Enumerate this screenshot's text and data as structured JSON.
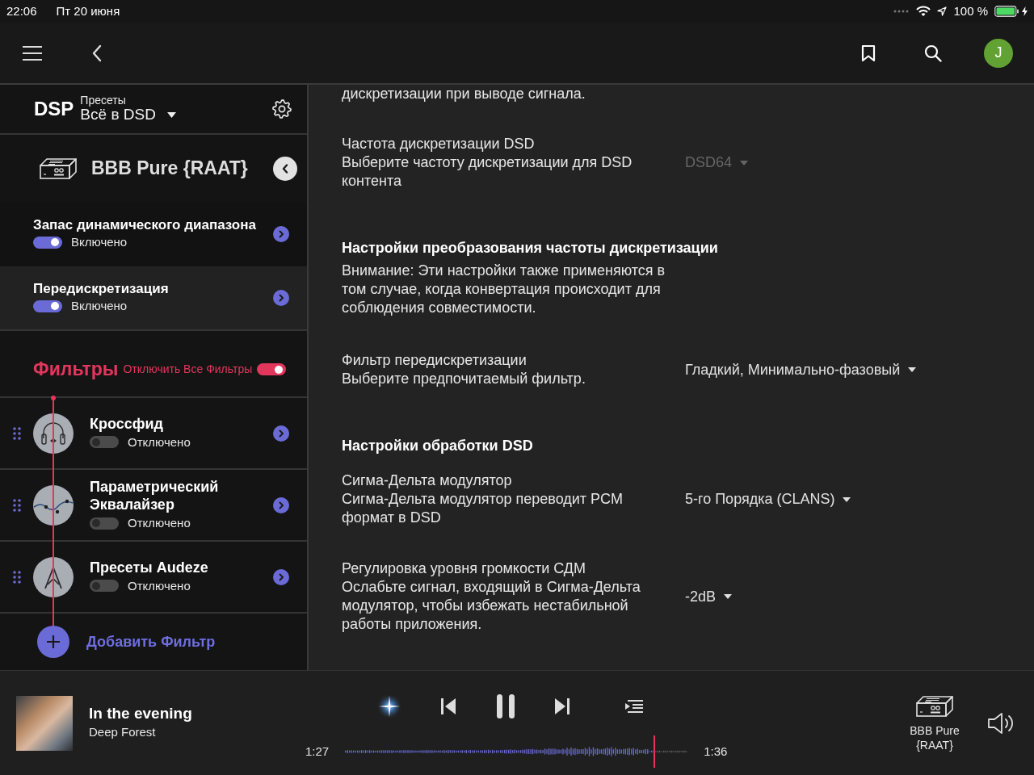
{
  "status_bar": {
    "time": "22:06",
    "date": "Пт 20 июня",
    "battery": "100 %"
  },
  "top_bar": {
    "avatar": "J"
  },
  "dsp_panel": {
    "title": "DSP",
    "presets_label": "Пресеты",
    "preset": "Всё в DSD",
    "device": "BBB Pure {RAAT}",
    "items": [
      {
        "title": "Запас динамического диапазона",
        "status": "Включено",
        "on": true,
        "selected": false
      },
      {
        "title": "Передискретизация",
        "status": "Включено",
        "on": true,
        "selected": true
      }
    ],
    "filters": {
      "title": "Фильтры",
      "disable_all_label": "Отключить Все Фильтры",
      "disable_all_on": true,
      "items": [
        {
          "kind": "crossfeed",
          "title": "Кроссфид",
          "status": "Отключено",
          "on": false
        },
        {
          "kind": "equalizer",
          "title": "Параметрический Эквалайзер",
          "status": "Отключено",
          "on": false
        },
        {
          "kind": "preset",
          "title": "Пресеты Audeze",
          "status": "Отключено",
          "on": false
        }
      ],
      "add_label": "Добавить Фильтр"
    }
  },
  "settings": [
    {
      "kind": "fragment",
      "text": "дискретизации при выводе сигнала."
    },
    {
      "kind": "setting",
      "label": "Частота дискретизации DSD",
      "description": "Выберите частоту дискретизации для DSD контента",
      "value": "DSD64",
      "disabled": true
    },
    {
      "kind": "heading",
      "title": "Настройки преобразования частоты дискретизации",
      "description": "Внимание: Эти настройки также применяются в том случае, когда конвертация происходит для соблюдения совместимости."
    },
    {
      "kind": "setting",
      "label": "Фильтр передискретизации",
      "description": "Выберите предпочитаемый фильтр.",
      "value": "Гладкий, Минимально-фазовый",
      "disabled": false
    },
    {
      "kind": "heading",
      "title": "Настройки обработки DSD"
    },
    {
      "kind": "setting",
      "label": "Сигма-Дельта модулятор",
      "description": "Сигма-Дельта модулятор переводит PCM формат в DSD",
      "value": "5-го Порядка (CLANS)",
      "disabled": false
    },
    {
      "kind": "setting",
      "label": "Регулировка уровня громкости СДМ",
      "description": "Ослабьте сигнал, входящий в Сигма-Дельта модулятор, чтобы избежать нестабильной работы приложения.",
      "value": "-2dB",
      "disabled": false
    }
  ],
  "player": {
    "title": "In the evening",
    "artist": "Deep Forest",
    "elapsed": "1:27",
    "duration": "1:36",
    "progress": {
      "level": 0.9
    },
    "zone": "BBB Pure {RAAT}"
  }
}
